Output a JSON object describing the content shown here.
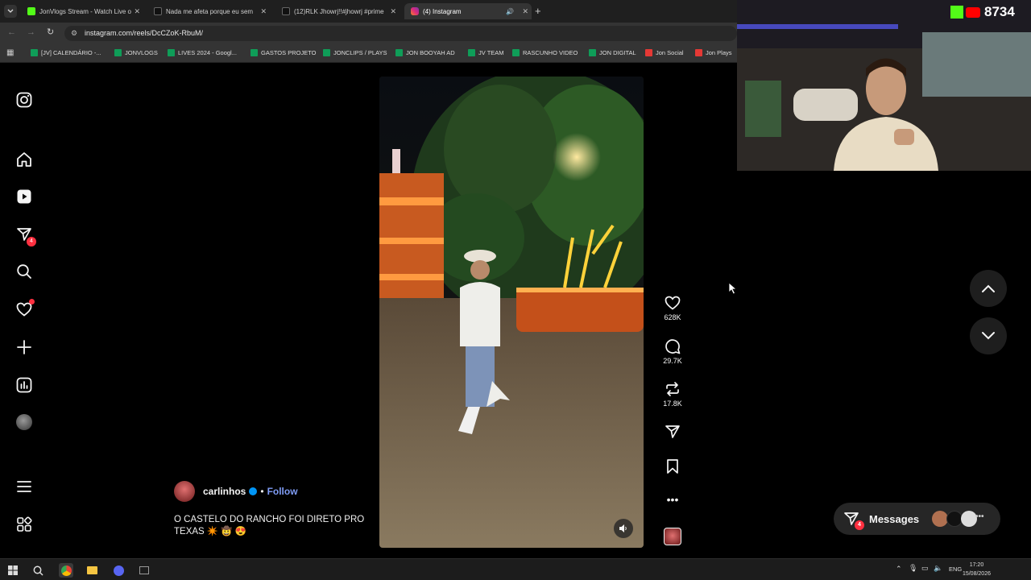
{
  "browser": {
    "tabs": [
      {
        "title": "JonVlogs Stream - Watch Live o",
        "color": "#53fc18"
      },
      {
        "title": "Nada me afeta porque eu sem",
        "color": "#ffffff"
      },
      {
        "title": "(12)RLK Jhowrj!!#jhowrj #prime",
        "color": "#ffffff"
      },
      {
        "title": "(4) Instagram",
        "color": "#e1306c"
      }
    ],
    "url": "instagram.com/reels/DcCZoK-RbuM/",
    "bookmarks": [
      {
        "label": "[JV] CALENDÁRIO -...",
        "color": "#0f9d58"
      },
      {
        "label": "JONVLOGS",
        "color": "#0f9d58"
      },
      {
        "label": "LIVES 2024 - Googl...",
        "color": "#0f9d58"
      },
      {
        "label": "GASTOS PROJETO",
        "color": "#0f9d58"
      },
      {
        "label": "JONCLIPS / PLAYS",
        "color": "#0f9d58"
      },
      {
        "label": "JON BOOYAH AD",
        "color": "#0f9d58"
      },
      {
        "label": "JV TEAM",
        "color": "#0f9d58"
      },
      {
        "label": "RASCUNHO VIDEO",
        "color": "#0f9d58"
      },
      {
        "label": "JON DIGITAL",
        "color": "#0f9d58"
      },
      {
        "label": "Jon Social",
        "color": "#e53935"
      },
      {
        "label": "Jon Plays",
        "color": "#e53935"
      }
    ]
  },
  "sidebar": {
    "items": [
      {
        "icon": "instagram-logo-icon"
      },
      {
        "icon": "home-icon"
      },
      {
        "icon": "reels-icon"
      },
      {
        "icon": "messages-icon",
        "badge": "4"
      },
      {
        "icon": "search-icon"
      },
      {
        "icon": "notifications-heart-icon"
      },
      {
        "icon": "create-plus-icon"
      },
      {
        "icon": "dashboard-icon"
      },
      {
        "icon": "profile-avatar-icon"
      },
      {
        "icon": "more-menu-icon"
      },
      {
        "icon": "also-from-meta-icon"
      }
    ]
  },
  "reel": {
    "author": "carlinhos",
    "follow_label": "Follow",
    "separator": "•",
    "caption": "O CASTELO DO RANCHO FOI DIRETO PRO TEXAS ✴️ 🤠 😍",
    "likes": "628K",
    "comments": "29.7K",
    "reposts": "17.8K"
  },
  "messages": {
    "label": "Messages",
    "badge": "4"
  },
  "overlay": {
    "kick_count": "8734"
  },
  "taskbar": {
    "lang": "ENG",
    "time": "17:20",
    "date": "15/08/2026"
  },
  "colors": {
    "accent_blue": "#0095f6",
    "follow_link": "#7f9cf5",
    "badge_red": "#ff3040",
    "kick_green": "#53fc18",
    "youtube_red": "#ff0000"
  }
}
